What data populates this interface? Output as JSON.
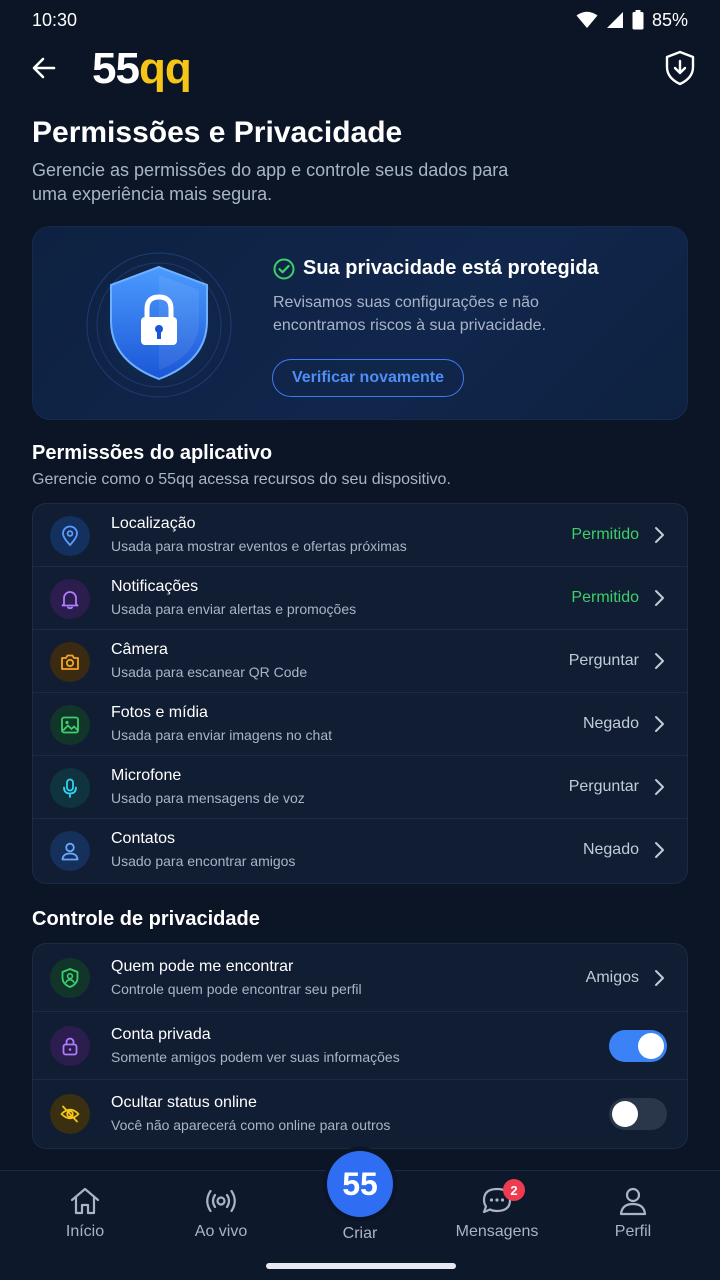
{
  "status_bar": {
    "time": "10:30",
    "battery": "85%"
  },
  "header": {
    "logo_white": "55",
    "logo_yellow": "qq"
  },
  "page": {
    "title": "Permissões e Privacidade",
    "subtitle": "Gerencie as permissões do app e controle seus dados para uma experiência mais segura."
  },
  "hero": {
    "title": "Sua privacidade está protegida",
    "description": "Revisamos suas configurações e não encontramos riscos à sua privacidade.",
    "button": "Verificar novamente"
  },
  "permissions": {
    "title": "Permissões do aplicativo",
    "subtitle": "Gerencie como o 55qq acessa recursos do seu dispositivo.",
    "items": [
      {
        "label": "Localização",
        "desc": "Usada para mostrar eventos e ofertas próximas",
        "status": "Permitido",
        "icon": "location-pin-icon",
        "color": "#3b82f6"
      },
      {
        "label": "Notificações",
        "desc": "Usada para enviar alertas e promoções",
        "status": "Permitido",
        "icon": "bell-icon",
        "color": "#a855f7"
      },
      {
        "label": "Câmera",
        "desc": "Usada para escanear QR Code",
        "status": "Perguntar",
        "icon": "camera-icon",
        "color": "#f59e0b"
      },
      {
        "label": "Fotos e mídia",
        "desc": "Usada para enviar imagens no chat",
        "status": "Negado",
        "icon": "image-icon",
        "color": "#22c55e"
      },
      {
        "label": "Microfone",
        "desc": "Usado para mensagens de voz",
        "status": "Perguntar",
        "icon": "microphone-icon",
        "color": "#22d3ee"
      },
      {
        "label": "Contatos",
        "desc": "Usado para encontrar amigos",
        "status": "Negado",
        "icon": "user-icon",
        "color": "#60a5fa"
      }
    ]
  },
  "privacy": {
    "title": "Controle de privacidade",
    "items": [
      {
        "label": "Quem pode me encontrar",
        "desc": "Controle quem pode encontrar seu perfil",
        "status": "Amigos",
        "icon": "user-shield-icon",
        "color": "#22c55e"
      },
      {
        "label": "Conta privada",
        "desc": "Somente amigos podem ver suas informações",
        "toggle": true,
        "icon": "lock-icon",
        "color": "#a855f7"
      },
      {
        "label": "Ocultar status online",
        "desc": "Você não aparecerá como online para outros",
        "toggle": false,
        "icon": "eye-off-icon",
        "color": "#f5c518"
      }
    ]
  },
  "nav": {
    "home": "Início",
    "live": "Ao vivo",
    "create_logo": "55",
    "create": "Criar",
    "messages": "Mensagens",
    "messages_badge": "2",
    "profile": "Perfil"
  }
}
